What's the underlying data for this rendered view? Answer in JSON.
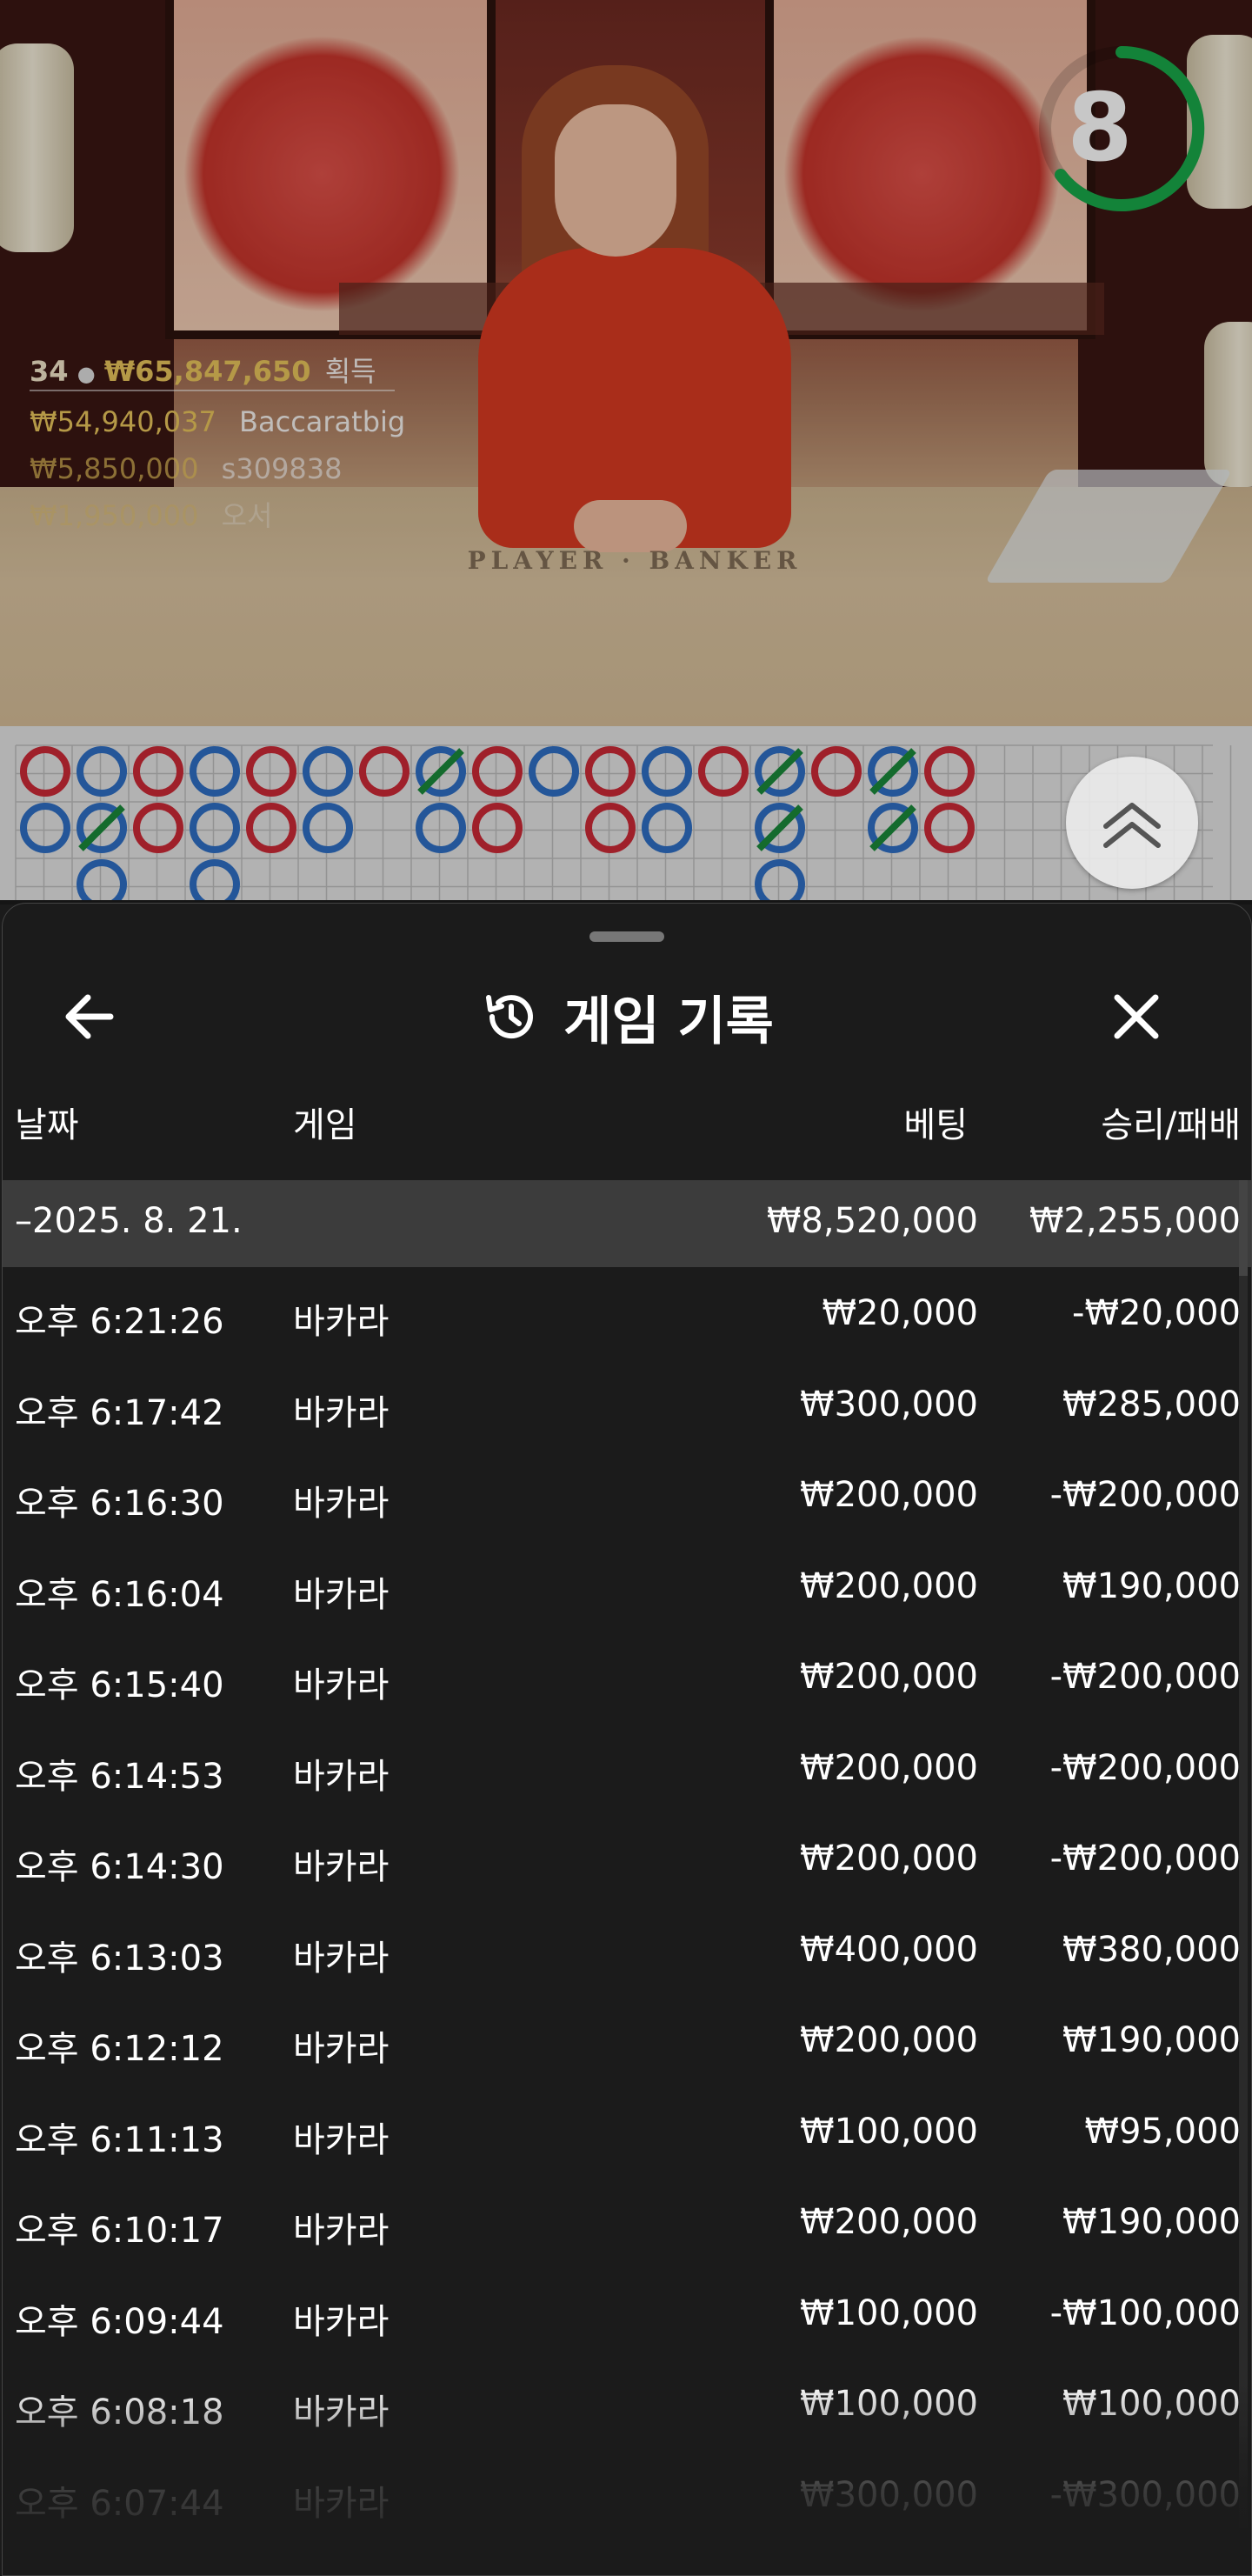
{
  "video": {
    "timer": "8",
    "table_label": "PLAYER  ·  BANKER",
    "winners_header": {
      "count": "34",
      "total": "₩65,847,650",
      "label": "획득"
    },
    "winners": [
      {
        "amount": "₩54,940,037",
        "name": "Baccaratbig"
      },
      {
        "amount": "₩5,850,000",
        "name": "s309838"
      },
      {
        "amount": "₩1,950,000",
        "name": "오서"
      }
    ]
  },
  "roadmap": {
    "colors": {
      "player": "#2f6fc4",
      "banker": "#cc2a36",
      "tie": "#1a8a3a"
    }
  },
  "sheet": {
    "title": "게임 기록",
    "columns": {
      "date": "날짜",
      "game": "게임",
      "bet": "베팅",
      "result": "승리/패배"
    },
    "summary": {
      "date": "–2025. 8. 21.",
      "bet": "₩8,520,000",
      "result": "₩2,255,000"
    },
    "rows": [
      {
        "time": "오후 6:21:26",
        "game": "바카라",
        "bet": "₩20,000",
        "result": "-₩20,000"
      },
      {
        "time": "오후 6:17:42",
        "game": "바카라",
        "bet": "₩300,000",
        "result": "₩285,000"
      },
      {
        "time": "오후 6:16:30",
        "game": "바카라",
        "bet": "₩200,000",
        "result": "-₩200,000"
      },
      {
        "time": "오후 6:16:04",
        "game": "바카라",
        "bet": "₩200,000",
        "result": "₩190,000"
      },
      {
        "time": "오후 6:15:40",
        "game": "바카라",
        "bet": "₩200,000",
        "result": "-₩200,000"
      },
      {
        "time": "오후 6:14:53",
        "game": "바카라",
        "bet": "₩200,000",
        "result": "-₩200,000"
      },
      {
        "time": "오후 6:14:30",
        "game": "바카라",
        "bet": "₩200,000",
        "result": "-₩200,000"
      },
      {
        "time": "오후 6:13:03",
        "game": "바카라",
        "bet": "₩400,000",
        "result": "₩380,000"
      },
      {
        "time": "오후 6:12:12",
        "game": "바카라",
        "bet": "₩200,000",
        "result": "₩190,000"
      },
      {
        "time": "오후 6:11:13",
        "game": "바카라",
        "bet": "₩100,000",
        "result": "₩95,000"
      },
      {
        "time": "오후 6:10:17",
        "game": "바카라",
        "bet": "₩200,000",
        "result": "₩190,000"
      },
      {
        "time": "오후 6:09:44",
        "game": "바카라",
        "bet": "₩100,000",
        "result": "-₩100,000"
      },
      {
        "time": "오후 6:08:18",
        "game": "바카라",
        "bet": "₩100,000",
        "result": "₩100,000"
      },
      {
        "time": "오후 6:07:44",
        "game": "바카라",
        "bet": "₩300,000",
        "result": "-₩300,000"
      }
    ]
  }
}
